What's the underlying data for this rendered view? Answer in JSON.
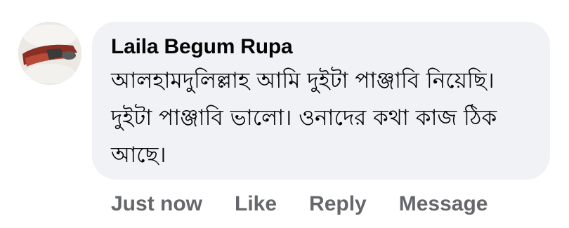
{
  "comment": {
    "author": "Laila Begum Rupa",
    "text": "আলহামদুলিল্লাহ আমি দুইটা পাঞ্জাবি নিয়েছি। দুইটা পাঞ্জাবি ভালো। ওনাদের কথা কাজ ঠিক আছে।"
  },
  "actions": {
    "timestamp": "Just now",
    "like": "Like",
    "reply": "Reply",
    "message": "Message"
  },
  "colors": {
    "bubble_bg": "#f0f2f5",
    "text": "#050505",
    "secondary_text": "#65676b"
  }
}
